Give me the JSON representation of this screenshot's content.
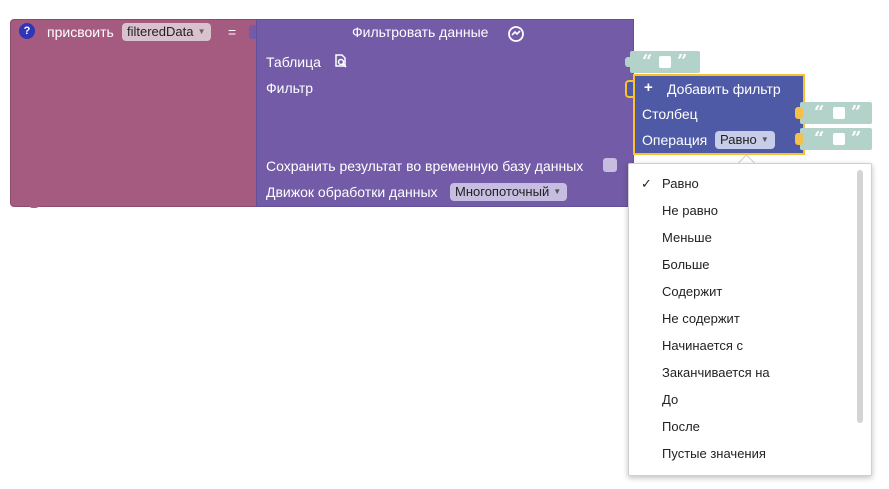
{
  "assign": {
    "help_glyph": "?",
    "label": "присвоить",
    "variable": "filteredData",
    "equals": "="
  },
  "filter_block": {
    "title": "Фильтровать данные",
    "table_label": "Таблица",
    "filter_label": "Фильтр",
    "save_label": "Сохранить результат во временную базу данных",
    "engine_label": "Движок обработки данных",
    "engine_value": "Многопоточный"
  },
  "add_filter": {
    "title": "Добавить фильтр",
    "plus": "+",
    "column_label": "Столбец",
    "operation_label": "Операция",
    "operation_value": "Равно"
  },
  "quote_open": "“",
  "quote_close": "”",
  "dropdown": {
    "checkmark": "✓",
    "items": [
      "Равно",
      "Не равно",
      "Меньше",
      "Больше",
      "Содержит",
      "Не содержит",
      "Начинается с",
      "Заканчивается на",
      "До",
      "После",
      "Пустые значения"
    ]
  },
  "colors": {
    "assign_block": "#a55b80",
    "filter_block": "#735ba7",
    "add_filter_block": "#4f5aa6",
    "string_block": "#b3d2c9",
    "selection_outline": "#fbc02d"
  }
}
